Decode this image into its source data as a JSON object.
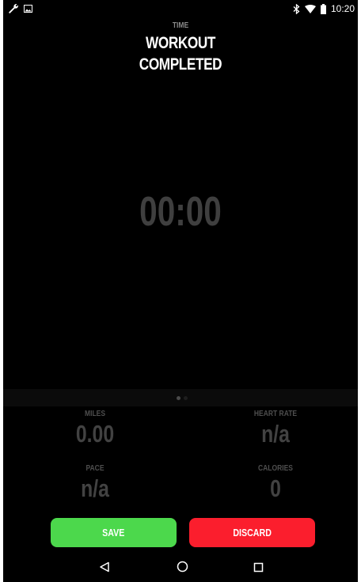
{
  "status_bar": {
    "left_icons": [
      "wrench-icon",
      "image-icon"
    ],
    "right_icons": [
      "bluetooth-icon",
      "wifi-icon",
      "battery-icon"
    ],
    "time": "10:20"
  },
  "header": {
    "time_label": "TIME",
    "title_line1": "WORKOUT",
    "title_line2": "COMPLETED"
  },
  "timer": {
    "value": "00:00"
  },
  "pager": {
    "pages": 2,
    "active_index": 0
  },
  "stats": {
    "miles": {
      "label": "MILES",
      "value": "0.00"
    },
    "heart_rate": {
      "label": "HEART RATE",
      "value": "n/a"
    },
    "pace": {
      "label": "PACE",
      "value": "n/a"
    },
    "calories": {
      "label": "CALORIES",
      "value": "0"
    }
  },
  "actions": {
    "save_label": "SAVE",
    "discard_label": "DISCARD",
    "save_color": "#4cd84c",
    "discard_color": "#fb1e2d"
  },
  "nav_bar": {
    "icons": [
      "back-icon",
      "home-icon",
      "recents-icon"
    ]
  }
}
